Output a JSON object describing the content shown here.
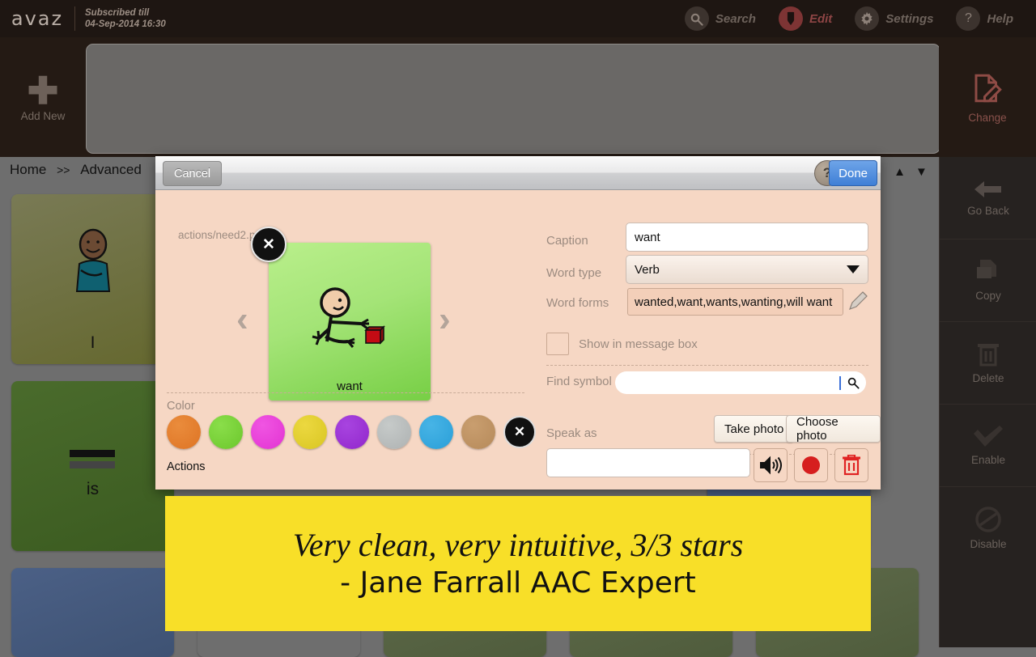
{
  "topbar": {
    "logo": "avaz",
    "subscription_label": "Subscribed till",
    "subscription_date": "04-Sep-2014 16:30",
    "items": [
      {
        "label": "Search",
        "icon": "search-icon",
        "active": false
      },
      {
        "label": "Edit",
        "icon": "pencil-icon",
        "active": true
      },
      {
        "label": "Settings",
        "icon": "gear-icon",
        "active": false
      },
      {
        "label": "Help",
        "icon": "question-icon",
        "active": false
      }
    ]
  },
  "toolbar": {
    "add_new_label": "Add New",
    "add_new_icon": "plus-icon",
    "change_label": "Change",
    "change_icon": "edit-document-icon"
  },
  "breadcrumb": {
    "home": "Home",
    "separator": ">>",
    "current": "Advanced"
  },
  "board": {
    "tiles": [
      {
        "caption": "I",
        "color": "#6e7040"
      },
      {
        "caption": "is",
        "color": "#3f6023"
      },
      {
        "caption": "",
        "color": "#44597a"
      },
      {
        "caption": "",
        "color": "#3f6023"
      },
      {
        "caption": "",
        "color": "#6e6e6e"
      },
      {
        "caption": "",
        "color": "#6e6e6e"
      }
    ]
  },
  "sidebar": {
    "items": [
      {
        "label": "Go Back",
        "icon": "arrow-left-icon"
      },
      {
        "label": "Copy",
        "icon": "copy-icon"
      },
      {
        "label": "Delete",
        "icon": "trash-icon"
      },
      {
        "label": "Enable",
        "icon": "check-icon"
      },
      {
        "label": "Disable",
        "icon": "block-icon"
      }
    ],
    "scroll_up_icon": "triangle-up-icon",
    "scroll_down_icon": "triangle-down-icon"
  },
  "dialog": {
    "cancel_label": "Cancel",
    "help_label": "?",
    "done_label": "Done",
    "file_path": "actions/need2.png",
    "symbol_caption": "want",
    "close_icon": "close-icon",
    "prev_icon": "chevron-left-icon",
    "next_icon": "chevron-right-icon",
    "color_label": "Color",
    "actions_label": "Actions",
    "colors": [
      "#e07b2c",
      "#76cf36",
      "#e83fd8",
      "#e0ce2e",
      "#9b32d4",
      "#b8bcbc",
      "#35a8de",
      "#be9363"
    ],
    "clear_color_icon": "close-icon",
    "fields": {
      "caption_label": "Caption",
      "caption_value": "want",
      "word_type_label": "Word type",
      "word_type_value": "Verb",
      "word_forms_label": "Word forms",
      "word_forms_value": "wanted,want,wants,wanting,will want",
      "word_forms_edit_icon": "pencil-icon",
      "show_in_message_box_label": "Show in message box",
      "show_in_message_box_checked": false,
      "find_symbol_label": "Find symbol",
      "find_symbol_value": "",
      "find_symbol_icon": "search-icon",
      "take_photo_label": "Take photo",
      "choose_photo_label": "Choose photo",
      "speak_as_label": "Speak as",
      "speak_as_value": "",
      "speaker_icon": "speaker-icon",
      "record_icon": "record-icon",
      "delete_recording_icon": "trash-icon"
    }
  },
  "banner": {
    "line1": "Very clean, very intuitive, 3/3 stars",
    "line2": "- Jane Farrall AAC Expert",
    "color": "#f8df28"
  }
}
